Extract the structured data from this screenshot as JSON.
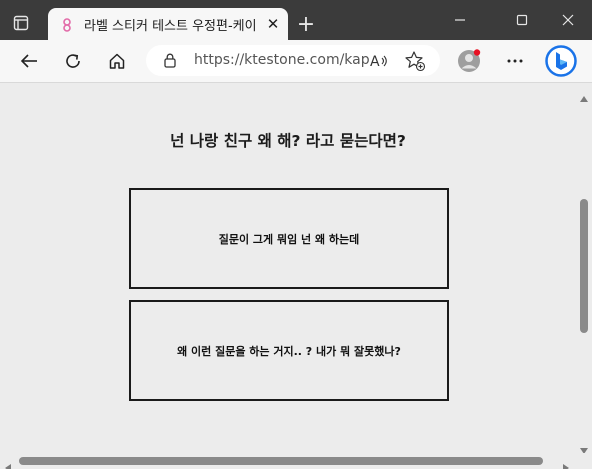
{
  "browser": {
    "tab_title": "라벨 스티커 테스트 우정편-케이",
    "tab_close": "✕",
    "new_tab": "+",
    "address": "https://ktestone.com/kap",
    "read_aloud_glyph": "A",
    "profile_badge_color": "#e81123",
    "accent_color": "#1a73e8"
  },
  "page": {
    "question": "넌 나랑 친구 왜 해? 라고 묻는다면?",
    "answers": [
      "질문이 그게 뭐임 넌 왜 하는데",
      "왜 이런 질문을 하는 거지.. ? 내가 뭐 잘못했나?"
    ]
  }
}
